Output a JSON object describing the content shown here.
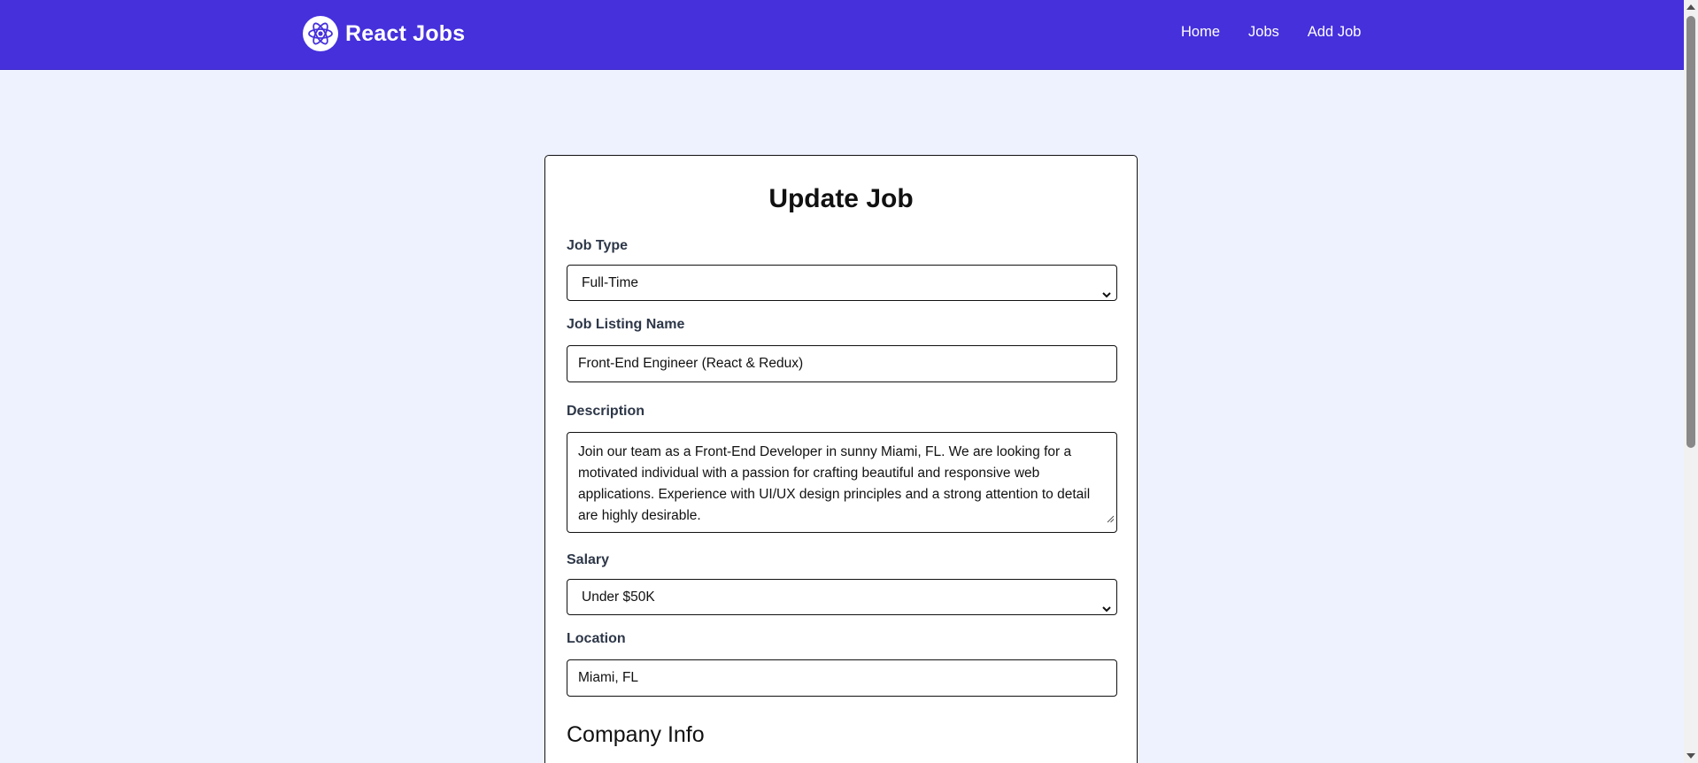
{
  "navbar": {
    "brand_title": "React Jobs",
    "brand_icon": "react-atom-icon",
    "background_color": "#4530dc",
    "links": [
      {
        "label": "Home"
      },
      {
        "label": "Jobs"
      },
      {
        "label": "Add Job"
      }
    ]
  },
  "form": {
    "title": "Update Job",
    "job_type": {
      "label": "Job Type",
      "value": "Full-Time"
    },
    "listing_name": {
      "label": "Job Listing Name",
      "value": "Front-End Engineer (React & Redux)"
    },
    "description": {
      "label": "Description",
      "value": "Join our team as a Front-End Developer in sunny Miami, FL. We are looking for a motivated individual with a passion for crafting beautiful and responsive web applications. Experience with UI/UX design principles and a strong attention to detail are highly desirable."
    },
    "salary": {
      "label": "Salary",
      "value": "Under $50K"
    },
    "location": {
      "label": "Location",
      "value": "Miami, FL"
    },
    "company_section_title": "Company Info"
  },
  "colors": {
    "page_background": "#eef2ff",
    "card_background": "#ffffff"
  }
}
